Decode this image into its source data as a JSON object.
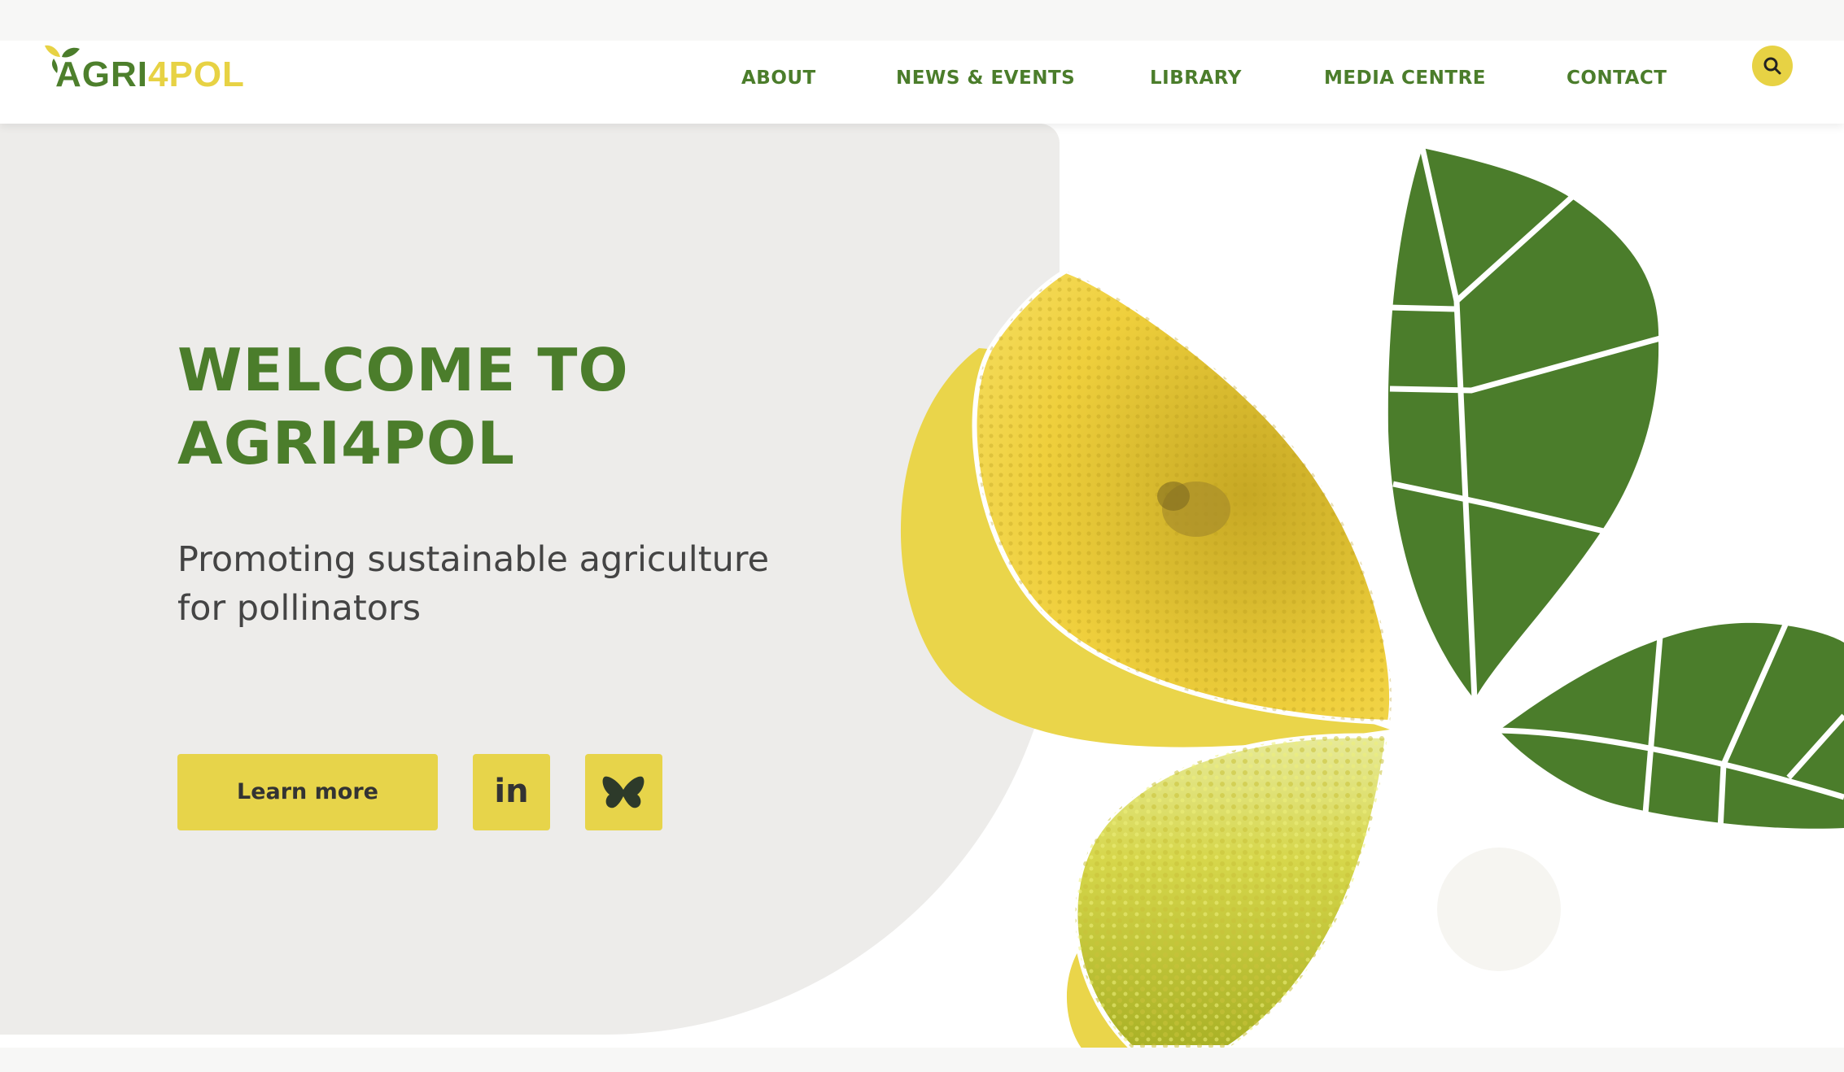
{
  "header": {
    "logo": {
      "part1": "AGRI",
      "part2": "4POL"
    },
    "nav": [
      {
        "label": "ABOUT"
      },
      {
        "label": "NEWS & EVENTS"
      },
      {
        "label": "LIBRARY"
      },
      {
        "label": "MEDIA CENTRE"
      },
      {
        "label": "CONTACT"
      }
    ],
    "search_icon": "search-icon"
  },
  "hero": {
    "title_line1": "WELCOME TO",
    "title_line2": "AGRI4POL",
    "subtitle_line1": "Promoting sustainable agriculture",
    "subtitle_line2": "for pollinators",
    "learn_more": "Learn more",
    "linkedin_label": "in",
    "bluesky_icon": "butterfly-icon"
  },
  "colors": {
    "brand_green": "#4b7d2b",
    "brand_yellow": "#e7d44a",
    "panel_gray": "#edecea"
  }
}
